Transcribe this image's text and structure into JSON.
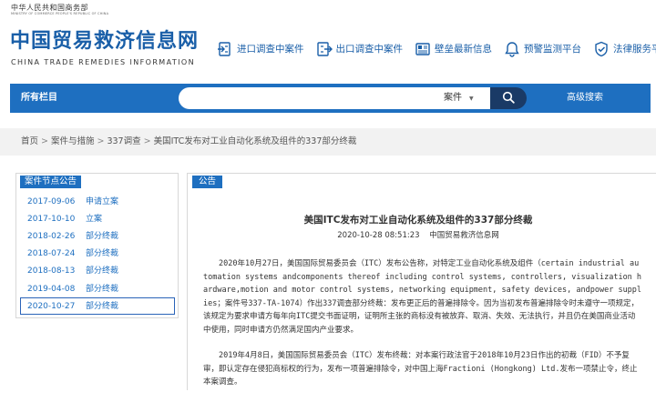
{
  "header": {
    "ministry_cn": "中华人民共和国商务部",
    "ministry_en": "MINISTRY OF COMMERCE PEOPLE'S REPUBLIC OF CHINA",
    "site_title": "中国贸易救济信息网",
    "site_title_en": "CHINA TRADE REMEDIES INFORMATION",
    "quicklinks": [
      {
        "label": "进口调查中案件",
        "icon": "import-doc-icon"
      },
      {
        "label": "出口调查中案件",
        "icon": "export-doc-icon"
      },
      {
        "label": "壁垒最新信息",
        "icon": "barrier-news-icon"
      },
      {
        "label": "预警监测平台",
        "icon": "bell-icon"
      },
      {
        "label": "法律服务平台",
        "icon": "shield-check-icon"
      }
    ]
  },
  "nav": {
    "all_columns": "所有栏目",
    "search_value": "",
    "search_type": "案件",
    "advanced_search": "高级搜索"
  },
  "breadcrumb": {
    "items": [
      "首页",
      "案件与措施",
      "337调查",
      "美国ITC发布对工业自动化系统及组件的337部分终裁"
    ]
  },
  "sidebar": {
    "title": "案件节点公告",
    "nodes": [
      {
        "date": "2017-09-06",
        "label": "申请立案"
      },
      {
        "date": "2017-10-10",
        "label": "立案"
      },
      {
        "date": "2018-02-26",
        "label": "部分终裁"
      },
      {
        "date": "2018-07-24",
        "label": "部分终裁"
      },
      {
        "date": "2018-08-13",
        "label": "部分终裁"
      },
      {
        "date": "2019-04-08",
        "label": "部分终裁"
      },
      {
        "date": "2020-10-27",
        "label": "部分终裁"
      }
    ]
  },
  "article": {
    "tag": "公告",
    "title": "美国ITC发布对工业自动化系统及组件的337部分终裁",
    "datetime": "2020-10-28 08:51:23",
    "source": "中国贸易救济信息网",
    "paragraphs": [
      "2020年10月27日，美国国际贸易委员会（ITC）发布公告称，对特定工业自动化系统及组件（certain industrial automation systems andcomponents thereof including control systems, controllers, visualization hardware,motion and motor control systems, networking equipment, safety devices, andpower supplies；案件号337-TA-1074）作出337调查部分终裁：发布更正后的普遍排除令。因为当初发布普遍排除令时未遵守一项规定，该规定为要求申请方每年向ITC提交书面证明，证明所主张的商标没有被放弃、取消、失效、无法执行，并且仍在美国商业活动中使用，同时申请方仍然满足国内产业要求。",
      "2019年4月8日，美国国际贸易委员会（ITC）发布终裁：对本案行政法官于2018年10月23日作出的初裁（FID）不予复审，即认定存在侵犯商标权的行为，发布一项普遍排除令，对中国上海Fractioni (Hongkong) Ltd.发布一项禁止令，终止本案调查。"
    ]
  }
}
